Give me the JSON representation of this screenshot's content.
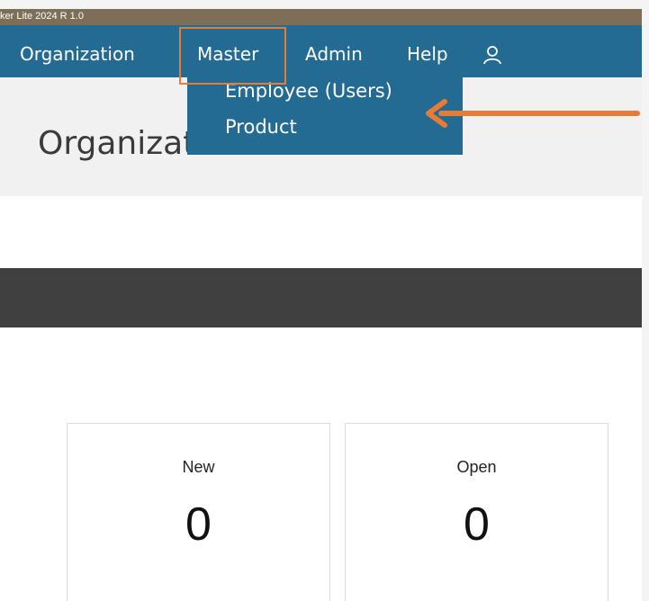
{
  "window": {
    "title": "ker Lite 2024 R 1.0"
  },
  "menubar": {
    "items": [
      {
        "label": "Organization"
      },
      {
        "label": "Master"
      },
      {
        "label": "Admin"
      },
      {
        "label": "Help"
      }
    ],
    "user_icon": "user-icon"
  },
  "dropdown": {
    "items": [
      {
        "label": "Employee (Users)"
      },
      {
        "label": "Product"
      }
    ]
  },
  "page": {
    "title": "Organization Dashboard"
  },
  "cards": [
    {
      "label": "New",
      "value": "0"
    },
    {
      "label": "Open",
      "value": "0"
    }
  ],
  "annotations": {
    "highlight_color": "#e87b36",
    "arrow_color": "#e87b36"
  },
  "colors": {
    "menu_bg": "#236b93",
    "title_bar": "#7d6e58",
    "dark_band": "#404040"
  }
}
